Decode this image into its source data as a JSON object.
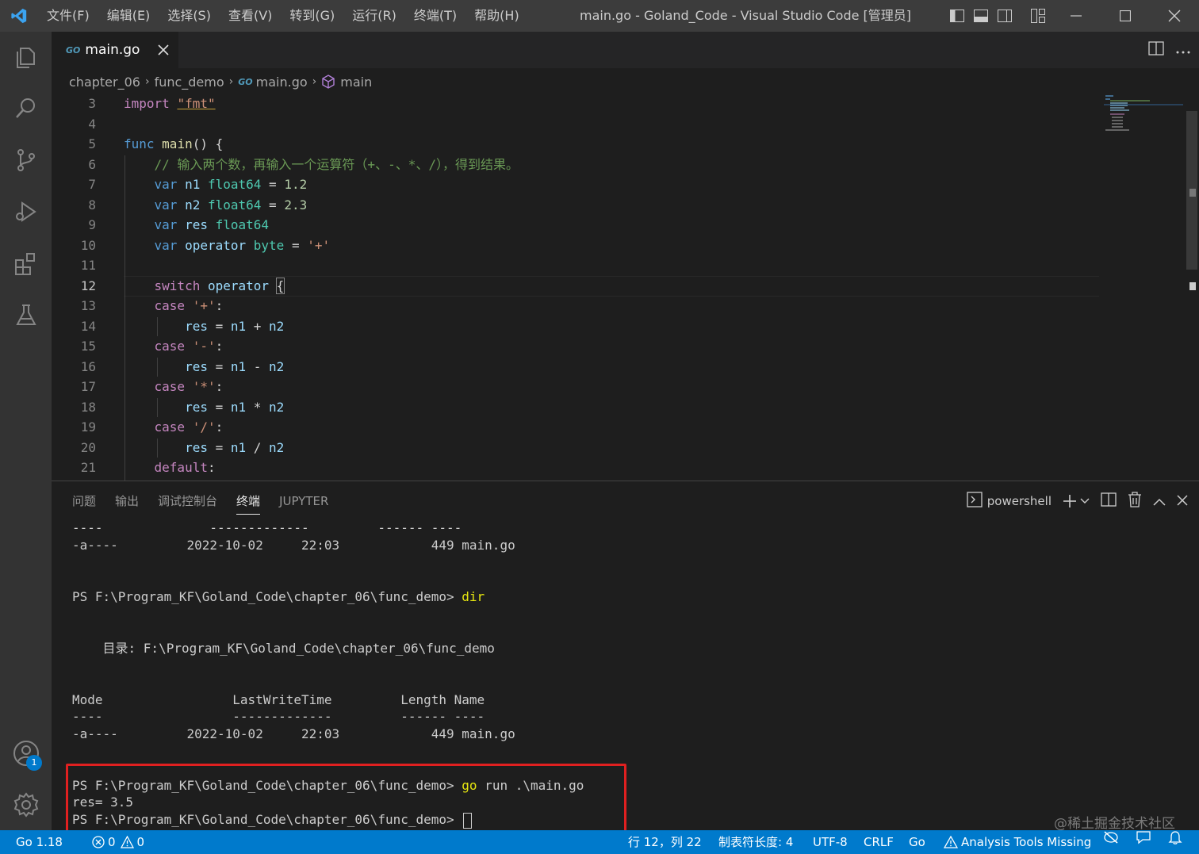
{
  "window": {
    "title": "main.go - Goland_Code - Visual Studio Code [管理员]",
    "menu": [
      "文件(F)",
      "编辑(E)",
      "选择(S)",
      "查看(V)",
      "转到(G)",
      "运行(R)",
      "终端(T)",
      "帮助(H)"
    ]
  },
  "activity_badge": "1",
  "tab": {
    "icon_text": "GO",
    "label": "main.go"
  },
  "breadcrumb": {
    "items": [
      "chapter_06",
      "func_demo",
      "main.go",
      "main"
    ]
  },
  "editor": {
    "line_numbers": [
      "3",
      "4",
      "5",
      "6",
      "7",
      "8",
      "9",
      "10",
      "11",
      "12",
      "13",
      "14",
      "15",
      "16",
      "17",
      "18",
      "19",
      "20",
      "21"
    ],
    "active_line": "12"
  },
  "panel": {
    "tabs": [
      "问题",
      "输出",
      "调试控制台",
      "终端",
      "JUPYTER"
    ],
    "active_tab": "终端",
    "terminal_name": "powershell",
    "terminal_lines": [
      "----              -------------         ------ ----",
      "-a----         2022-10-02     22:03            449 main.go",
      "",
      "",
      "PS F:\\Program_KF\\Goland_Code\\chapter_06\\func_demo> ",
      "",
      "",
      "    目录: F:\\Program_KF\\Goland_Code\\chapter_06\\func_demo",
      "",
      "",
      "Mode                 LastWriteTime         Length Name",
      "----                 -------------         ------ ----",
      "-a----         2022-10-02     22:03            449 main.go",
      "",
      "",
      "PS F:\\Program_KF\\Goland_Code\\chapter_06\\func_demo> ",
      "res= 3.5",
      "PS F:\\Program_KF\\Goland_Code\\chapter_06\\func_demo> "
    ],
    "cmd_dir": "dir",
    "cmd_go": "go",
    "cmd_go_rest": " run .\\main.go"
  },
  "watermark": "@稀土掘金技术社区",
  "statusbar": {
    "go_version": "Go 1.18",
    "errors": "0",
    "warnings": "0",
    "cursor_pos": "行 12，列 22",
    "indent": "制表符长度: 4",
    "encoding": "UTF-8",
    "eol": "CRLF",
    "language": "Go",
    "analysis": "Analysis Tools Missing"
  },
  "colors": {
    "accent": "#007acc",
    "highlight_box": "#e02020",
    "keyword": "#569cd6",
    "control_keyword": "#c586c0",
    "type": "#4ec9b0",
    "string": "#ce9178",
    "comment": "#6a9955"
  }
}
